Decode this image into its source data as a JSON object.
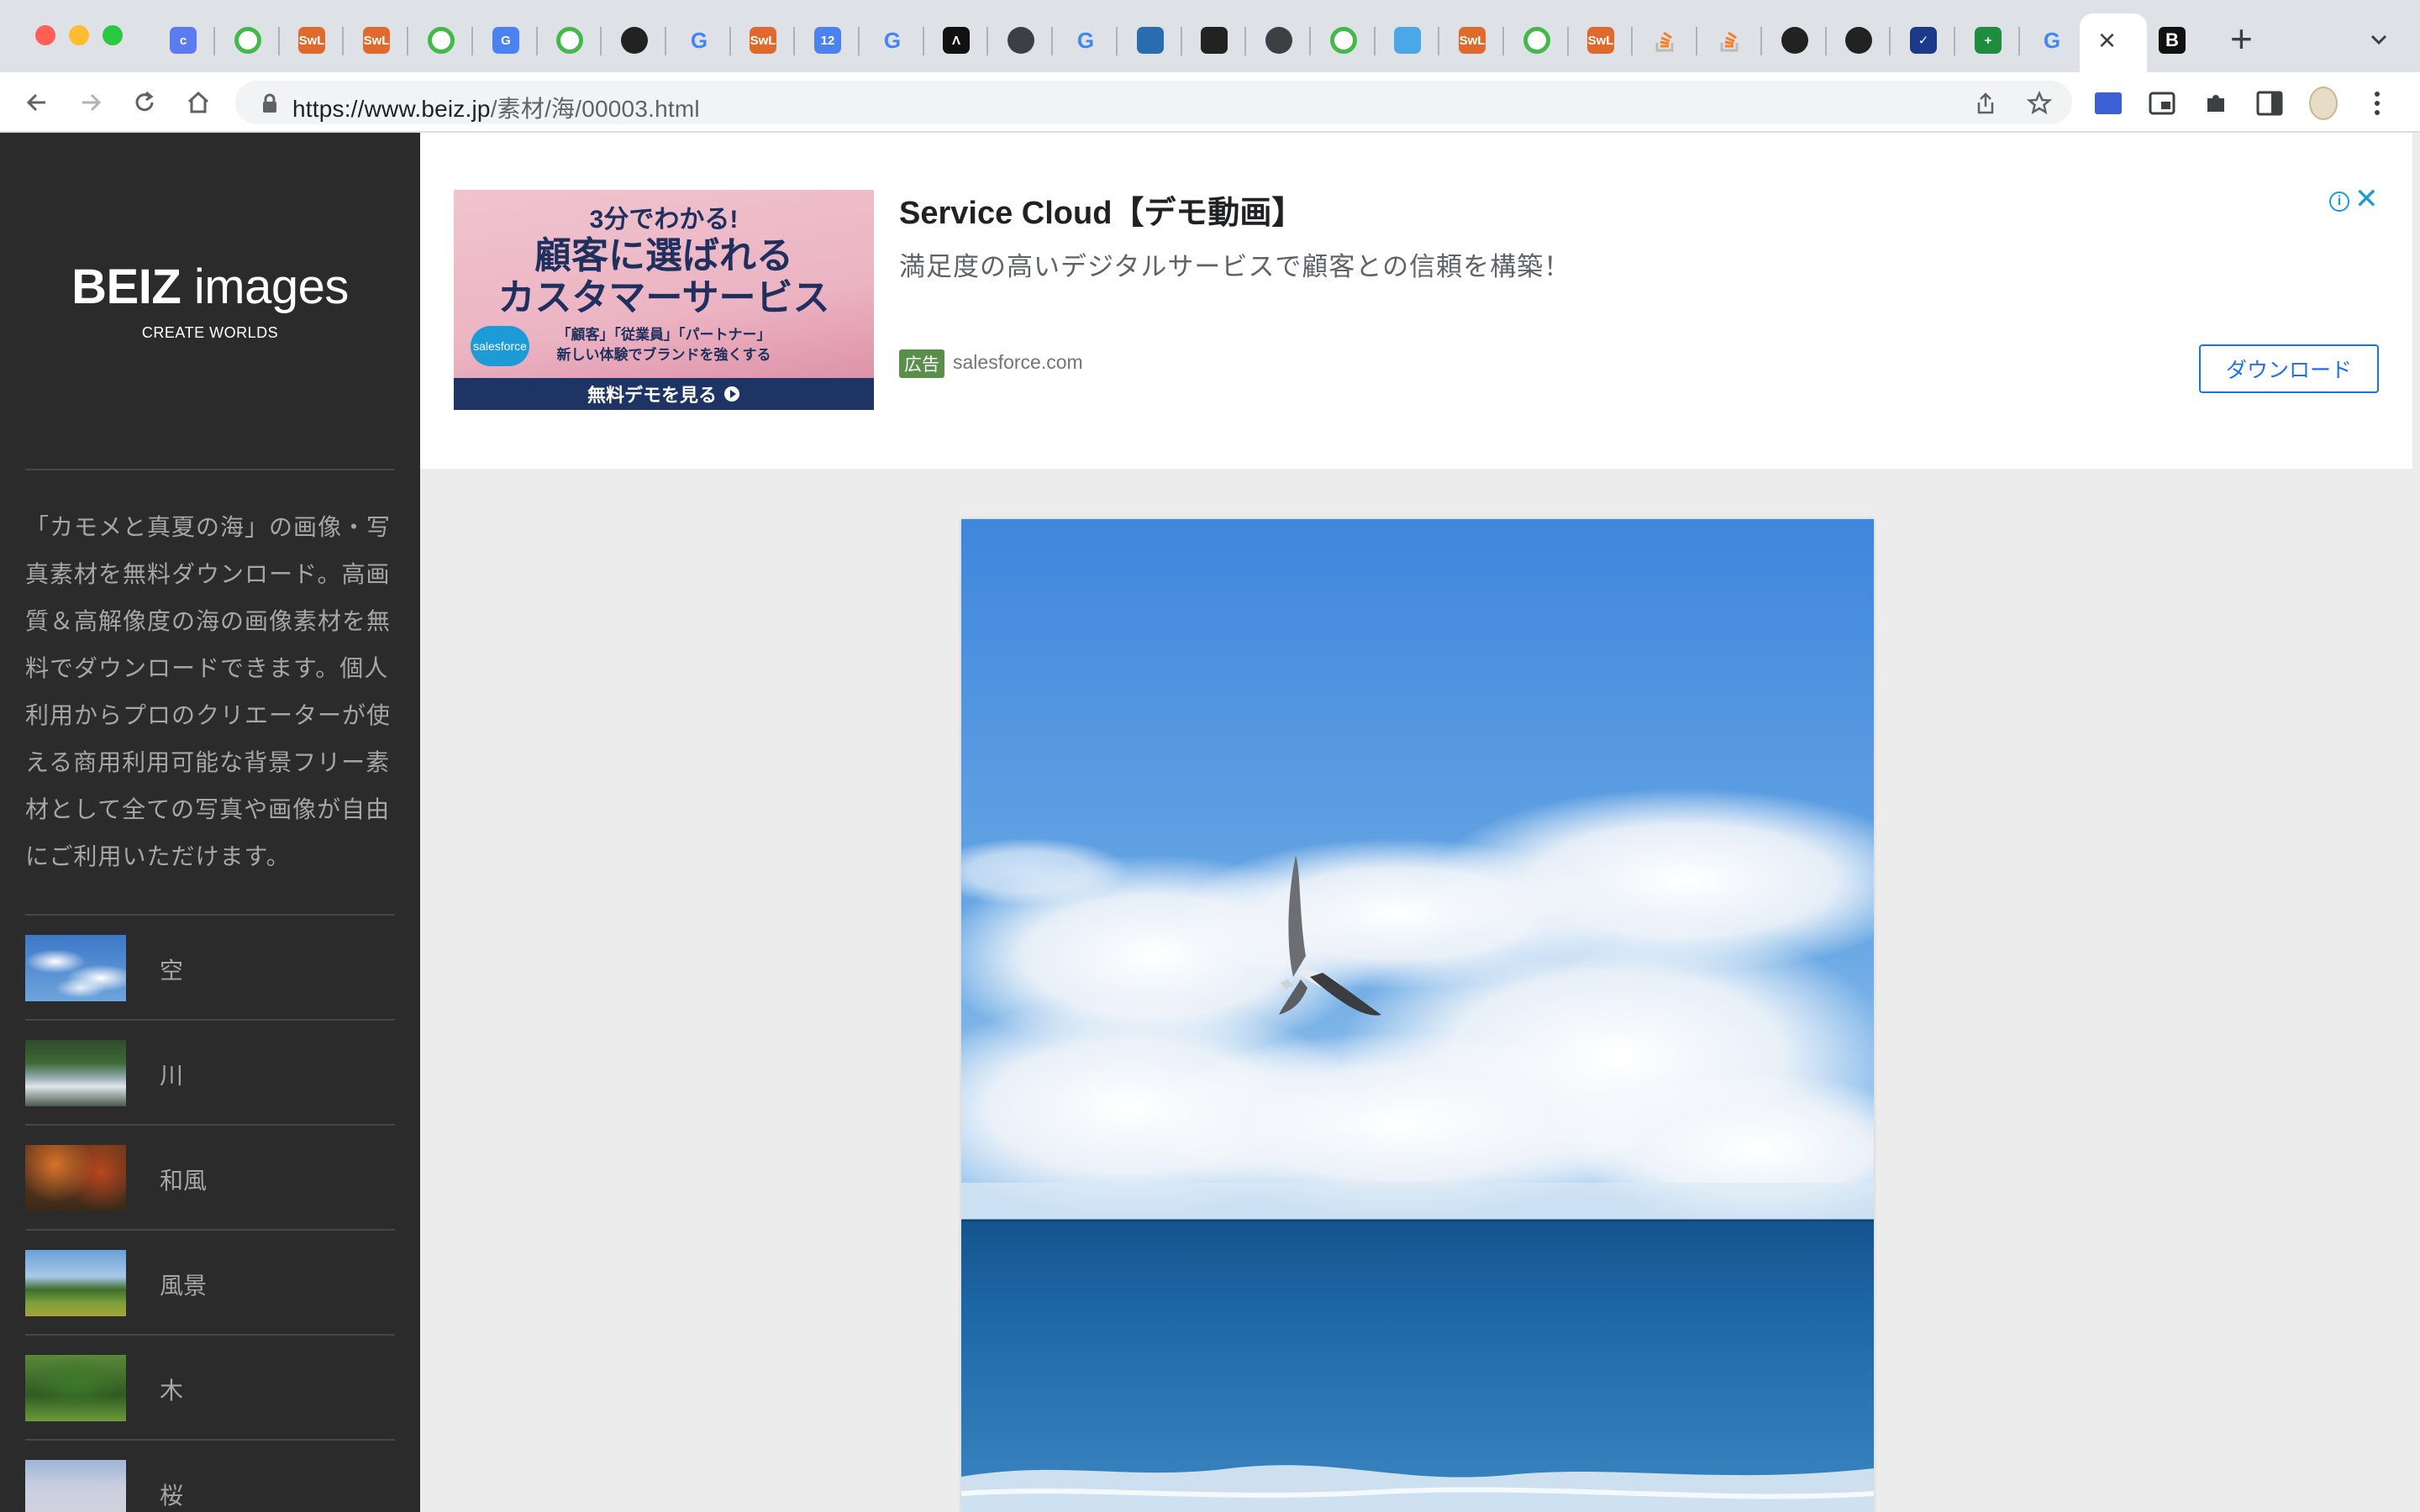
{
  "browser": {
    "url_host": "https://www.beiz.jp",
    "url_path": "/素材/海/00003.html",
    "active_tab_close": "×",
    "new_tab": "+"
  },
  "tabs": [
    {
      "icon": "c-icon",
      "color": "#5b7cf0",
      "glyph": "c"
    },
    {
      "icon": "green-circle-icon",
      "color": "#43b94a",
      "glyph": ""
    },
    {
      "icon": "swl-icon",
      "color": "#e06a2c",
      "glyph": "SwL"
    },
    {
      "icon": "swl-icon",
      "color": "#e06a2c",
      "glyph": "SwL"
    },
    {
      "icon": "green-circle-icon",
      "color": "#43b94a",
      "glyph": ""
    },
    {
      "icon": "google-translate-icon",
      "color": "#4a82f0",
      "glyph": "G"
    },
    {
      "icon": "green-circle-icon",
      "color": "#43b94a",
      "glyph": ""
    },
    {
      "icon": "github-icon",
      "color": "#222222",
      "glyph": ""
    },
    {
      "icon": "google-icon",
      "color": "#ffffff",
      "glyph": "G"
    },
    {
      "icon": "swl-icon",
      "color": "#e06a2c",
      "glyph": "SwL"
    },
    {
      "icon": "calendar-icon",
      "color": "#4a82f0",
      "glyph": "12"
    },
    {
      "icon": "google-icon",
      "color": "#ffffff",
      "glyph": "G"
    },
    {
      "icon": "a-icon",
      "color": "#111111",
      "glyph": "Λ"
    },
    {
      "icon": "globe-icon",
      "color": "#3c4043",
      "glyph": ""
    },
    {
      "icon": "google-icon",
      "color": "#ffffff",
      "glyph": "G"
    },
    {
      "icon": "square-icon",
      "color": "#2a6cb0",
      "glyph": ""
    },
    {
      "icon": "info-icon",
      "color": "#222222",
      "glyph": ""
    },
    {
      "icon": "globe-icon",
      "color": "#3c4043",
      "glyph": ""
    },
    {
      "icon": "green-circle-icon",
      "color": "#43b94a",
      "glyph": ""
    },
    {
      "icon": "edit-icon",
      "color": "#4aa8e8",
      "glyph": ""
    },
    {
      "icon": "swl-icon",
      "color": "#e06a2c",
      "glyph": "SwL"
    },
    {
      "icon": "green-circle-icon",
      "color": "#43b94a",
      "glyph": ""
    },
    {
      "icon": "swl-icon",
      "color": "#e06a2c",
      "glyph": "SwL"
    },
    {
      "icon": "stackoverflow-icon",
      "color": "#f48024",
      "glyph": ""
    },
    {
      "icon": "stackoverflow-icon",
      "color": "#f48024",
      "glyph": ""
    },
    {
      "icon": "github-icon",
      "color": "#222222",
      "glyph": ""
    },
    {
      "icon": "github-icon",
      "color": "#222222",
      "glyph": ""
    },
    {
      "icon": "checkmark-icon",
      "color": "#1b3a8a",
      "glyph": "✓"
    },
    {
      "icon": "sheets-icon",
      "color": "#1e8e3e",
      "glyph": "+"
    },
    {
      "icon": "google-icon",
      "color": "#ffffff",
      "glyph": "G"
    }
  ],
  "sidebar": {
    "logo_bold": "BEIZ",
    "logo_light": " images",
    "tagline": "CREATE WORLDS",
    "description": "「カモメと真夏の海」の画像・写真素材を無料ダウンロード。高画質＆高解像度の海の画像素材を無料でダウンロードできます。個人利用からプロのクリエーターが使える商用利用可能な背景フリー素材として全ての写真や画像が自由にご利用いただけます。",
    "categories": [
      {
        "label": "空"
      },
      {
        "label": "川"
      },
      {
        "label": "和風"
      },
      {
        "label": "風景"
      },
      {
        "label": "木"
      },
      {
        "label": "桜"
      }
    ]
  },
  "ad": {
    "banner_line1": "3分でわかる!",
    "banner_line2": "顧客に選ばれる",
    "banner_line3": "カスタマーサービス",
    "banner_line4": "「顧客」「従業員」「パートナー」",
    "banner_line5": "新しい体験でブランドを強くする",
    "banner_brand": "salesforce",
    "banner_cta": "無料デモを見る",
    "title": "Service Cloud【デモ動画】",
    "text": "満足度の高いデジタルサービスで顧客との信頼を構築！",
    "badge": "広告",
    "domain": "salesforce.com",
    "button": "ダウンロード",
    "info": "i",
    "close": "✕"
  }
}
